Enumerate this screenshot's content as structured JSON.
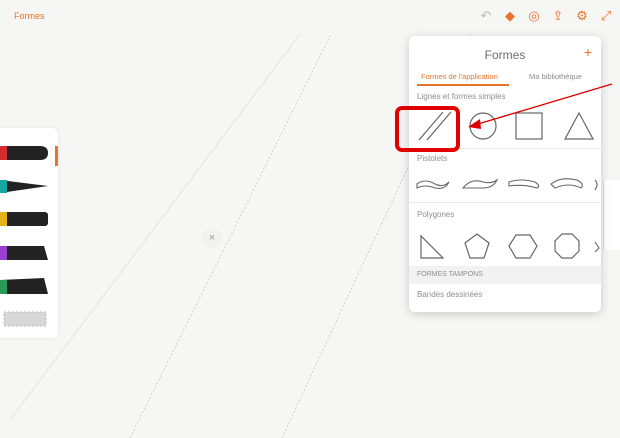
{
  "topbar": {
    "back_label": "Formes",
    "icons": [
      "undo-icon",
      "color-icon",
      "layers-icon",
      "share-icon",
      "settings-icon",
      "expand-icon"
    ]
  },
  "panel": {
    "title": "Formes",
    "add_label": "+",
    "tabs": [
      {
        "label": "Formes de l'application",
        "active": true
      },
      {
        "label": "Ma bibliothèque",
        "active": false
      }
    ],
    "sections": [
      {
        "label": "Lignes et formes simples",
        "items": [
          "parallel-lines-icon",
          "circle-icon",
          "square-icon",
          "triangle-icon"
        ]
      },
      {
        "label": "Pistolets",
        "items": [
          "french-curve-1-icon",
          "french-curve-2-icon",
          "french-curve-3-icon",
          "french-curve-4-icon"
        ]
      },
      {
        "label": "Polygones",
        "items": [
          "right-triangle-icon",
          "pentagon-icon",
          "hexagon-icon",
          "octagon-icon"
        ]
      }
    ],
    "stamp_header": "FORMES TAMPONS",
    "stamp_first_item": "Bandes dessinées"
  },
  "brushes": [
    {
      "name": "brush-red",
      "color": "#d42d2d"
    },
    {
      "name": "brush-teal",
      "color": "#1aa6a0"
    },
    {
      "name": "brush-yellow",
      "color": "#e6b21b"
    },
    {
      "name": "brush-purple",
      "color": "#9b3fd1"
    },
    {
      "name": "brush-green",
      "color": "#2a9b57"
    },
    {
      "name": "brush-pattern",
      "color": "#c9c9c9"
    }
  ],
  "colors": {
    "accent": "#e8742a",
    "highlight": "#e00000"
  },
  "canvas": {
    "center_marker": "×"
  }
}
